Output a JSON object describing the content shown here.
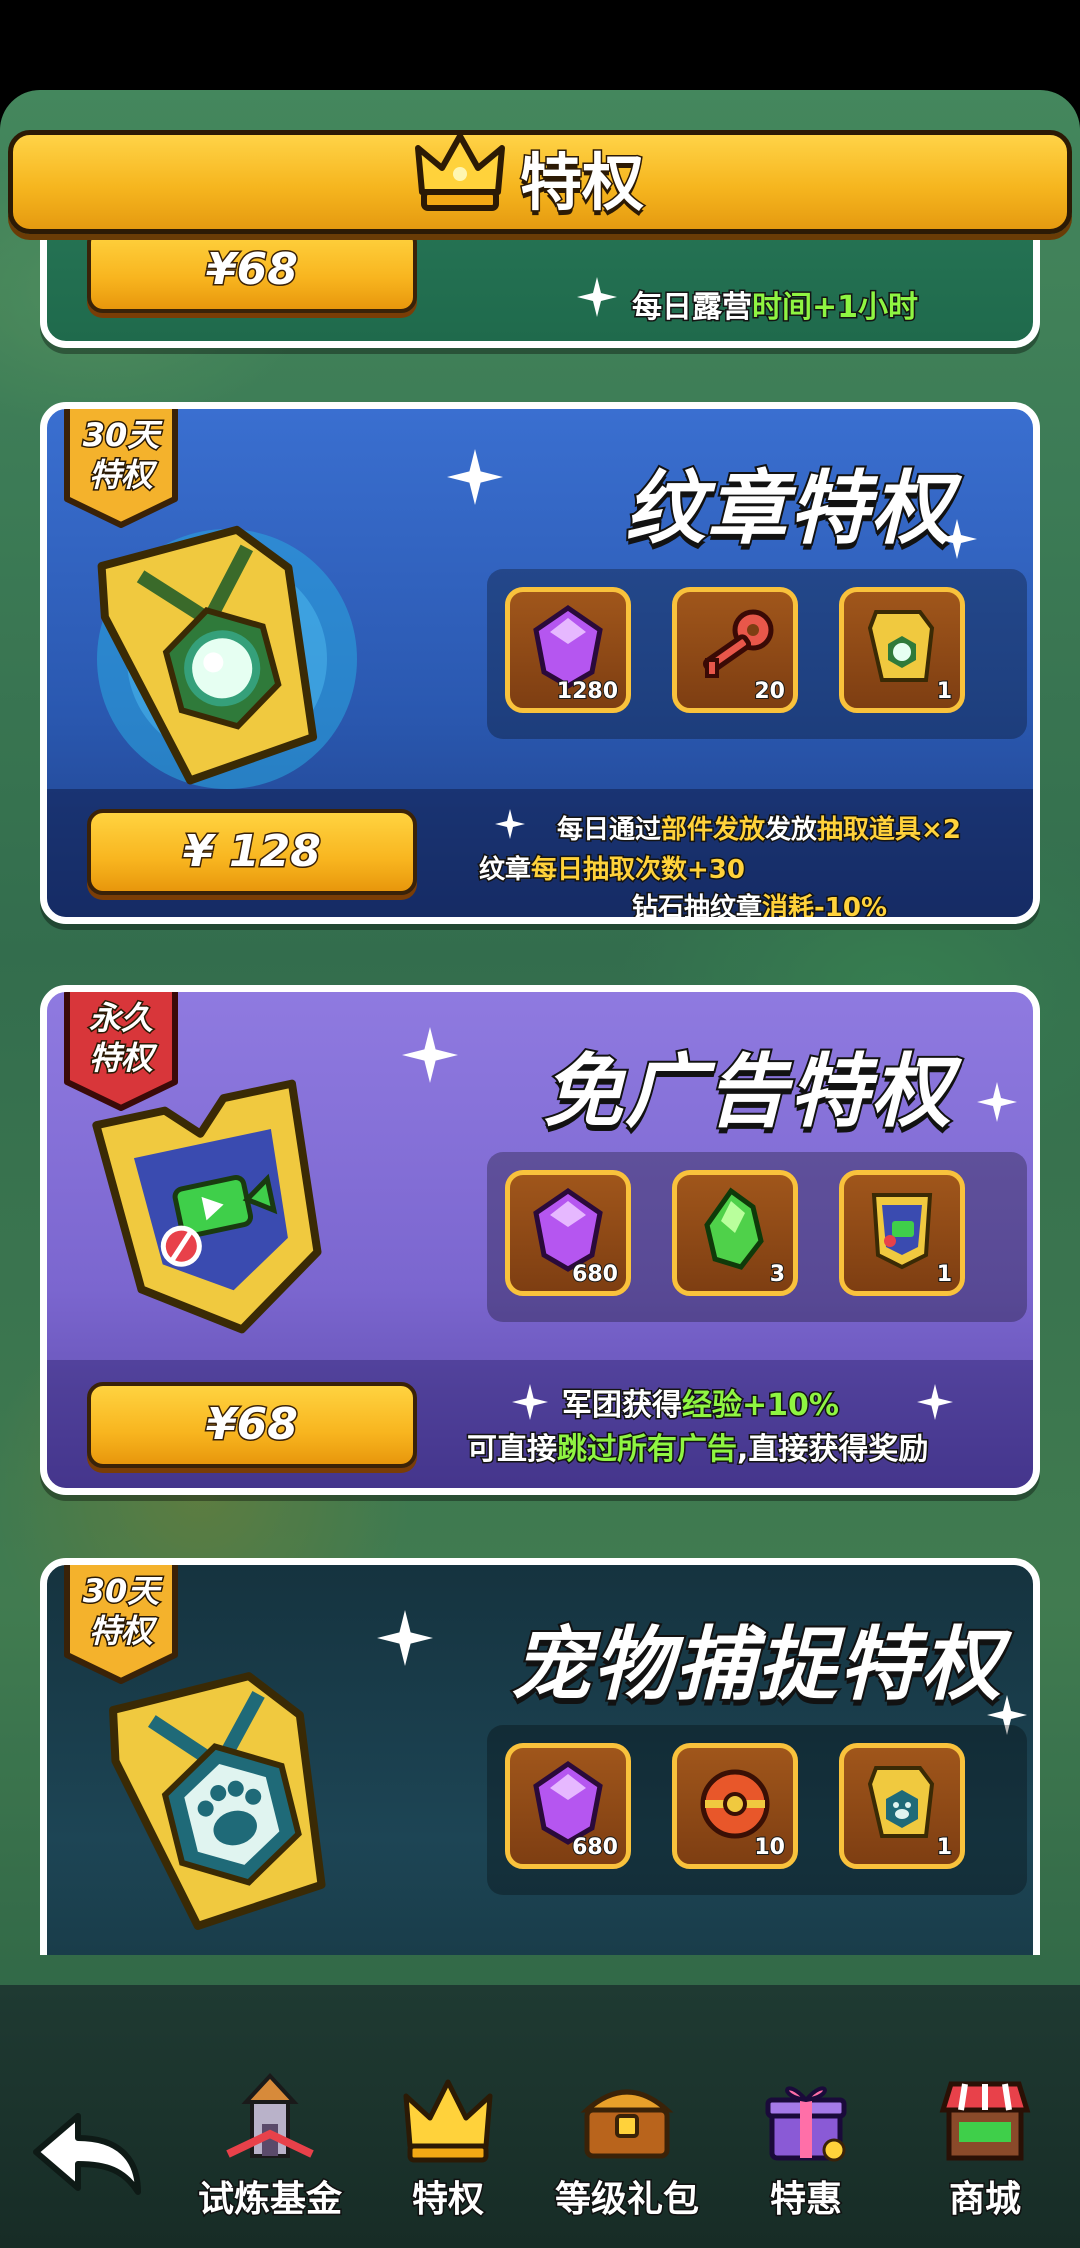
{
  "header": {
    "title": "特权"
  },
  "cards": [
    {
      "price": "¥68",
      "desc_parts": [
        "每日露营",
        "时间+1小时"
      ]
    },
    {
      "badge": [
        "30天",
        "特权"
      ],
      "title": "纹章特权",
      "rewards": [
        {
          "icon": "purple-gem-icon",
          "count": "1280"
        },
        {
          "icon": "red-key-icon",
          "count": "20"
        },
        {
          "icon": "emblem-icon",
          "count": "1"
        }
      ],
      "price": "¥ 128",
      "desc": [
        [
          "每日通过",
          "部件发放",
          "抽取道具×2"
        ],
        [
          "纹章",
          "每日抽取次数+30",
          ""
        ],
        [
          "钻石抽纹章",
          "消耗-10%",
          ""
        ]
      ]
    },
    {
      "badge": [
        "永久",
        "特权"
      ],
      "title": "免广告特权",
      "rewards": [
        {
          "icon": "purple-gem-icon",
          "count": "680"
        },
        {
          "icon": "green-crystal-icon",
          "count": "3"
        },
        {
          "icon": "no-ads-emblem-icon",
          "count": "1"
        }
      ],
      "price": "¥68",
      "desc": [
        [
          "军团获得",
          "经验+10%",
          ""
        ],
        [
          "可直接",
          "跳过所有广告",
          ",直接获得奖励"
        ]
      ]
    },
    {
      "badge": [
        "30天",
        "特权"
      ],
      "title": "宠物捕捉特权",
      "rewards": [
        {
          "icon": "purple-gem-icon",
          "count": "680"
        },
        {
          "icon": "capture-ball-icon",
          "count": "10"
        },
        {
          "icon": "paw-emblem-icon",
          "count": "1"
        }
      ]
    }
  ],
  "nav": {
    "back": "back-arrow-icon",
    "items": [
      {
        "label": "试炼基金",
        "icon": "tower-icon"
      },
      {
        "label": "特权",
        "icon": "crown-icon"
      },
      {
        "label": "等级礼包",
        "icon": "treasure-chest-icon"
      },
      {
        "label": "特惠",
        "icon": "gift-box-icon"
      },
      {
        "label": "商城",
        "icon": "shop-icon"
      }
    ]
  },
  "colors": {
    "accent_gold": "#f8b51f",
    "highlight_green": "#8ff542"
  }
}
